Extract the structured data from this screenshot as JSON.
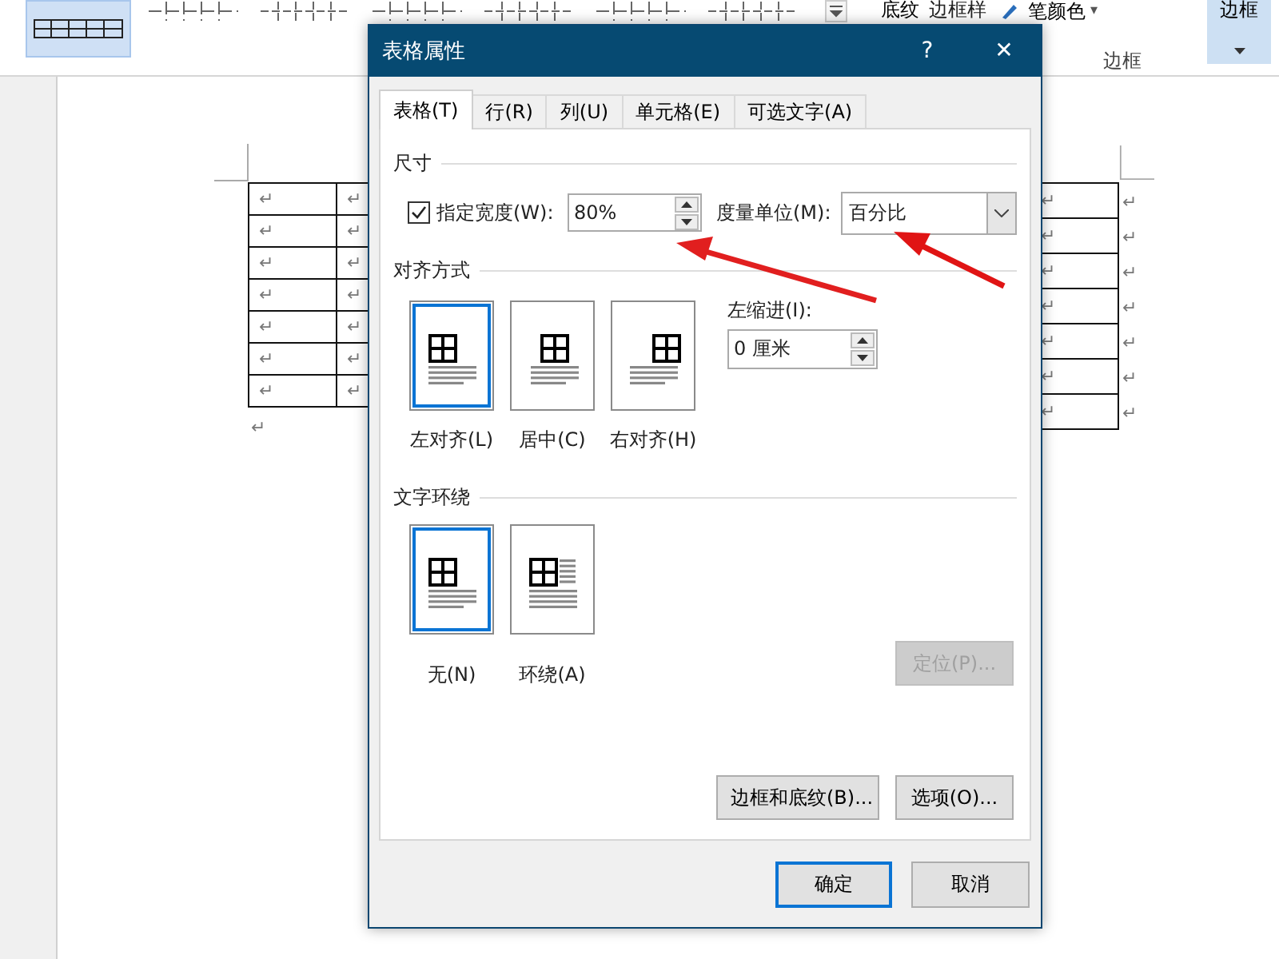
{
  "ribbon": {
    "table_styles": [
      {
        "selected": true
      },
      {
        "selected": false
      },
      {
        "selected": false
      },
      {
        "selected": false
      },
      {
        "selected": false
      },
      {
        "selected": false
      },
      {
        "selected": false
      }
    ],
    "shading": "底纹",
    "border_styles": "边框样",
    "pen_color": "笔颜色",
    "pen_caret": "▾",
    "borders_button": "边框",
    "group_label": "边框"
  },
  "document": {
    "left_table_rows": [
      [
        "↵",
        "↵"
      ],
      [
        "↵",
        "↵"
      ],
      [
        "↵",
        "↵"
      ],
      [
        "↵",
        "↵"
      ],
      [
        "↵",
        "↵"
      ],
      [
        "↵",
        "↵"
      ],
      [
        "↵",
        "↵"
      ]
    ],
    "right_table_rows": [
      [
        "↵",
        "↵"
      ],
      [
        "↵",
        "↵"
      ],
      [
        "↵",
        "↵"
      ],
      [
        "↵",
        "↵"
      ],
      [
        "↵",
        "↵"
      ],
      [
        "↵",
        "↵"
      ],
      [
        "↵",
        "↵"
      ]
    ],
    "paragraph_mark": "↵"
  },
  "dialog": {
    "title": "表格属性",
    "help": "?",
    "close": "✕",
    "tabs": [
      {
        "label": "表格(T)",
        "selected": true
      },
      {
        "label": "行(R)",
        "selected": false
      },
      {
        "label": "列(U)",
        "selected": false
      },
      {
        "label": "单元格(E)",
        "selected": false
      },
      {
        "label": "可选文字(A)",
        "selected": false
      }
    ],
    "size": {
      "heading": "尺寸",
      "width_checkbox": {
        "label": "指定宽度(W):",
        "checked": true
      },
      "width_value": "80%",
      "unit_label": "度量单位(M):",
      "unit_value": "百分比"
    },
    "alignment": {
      "heading": "对齐方式",
      "options": [
        {
          "kind": "left",
          "label": "左对齐(L)",
          "selected": true
        },
        {
          "kind": "center",
          "label": "居中(C)",
          "selected": false
        },
        {
          "kind": "right",
          "label": "右对齐(H)",
          "selected": false
        }
      ],
      "indent_label": "左缩进(I):",
      "indent_value": "0 厘米"
    },
    "wrapping": {
      "heading": "文字环绕",
      "options": [
        {
          "kind": "none",
          "label": "无(N)",
          "selected": true
        },
        {
          "kind": "around",
          "label": "环绕(A)",
          "selected": false
        }
      ],
      "position_button": {
        "label": "定位(P)...",
        "disabled": true
      }
    },
    "borders_shading_button": "边框和底纹(B)...",
    "options_button": "选项(O)...",
    "ok_button": "确定",
    "cancel_button": "取消"
  }
}
